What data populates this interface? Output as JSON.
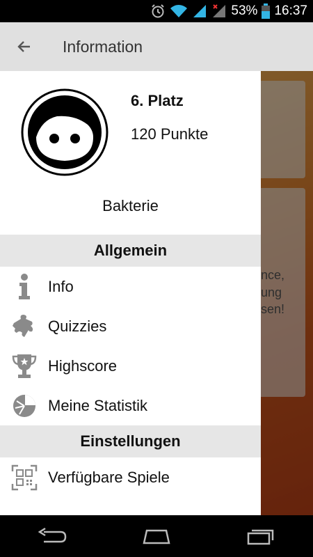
{
  "status_bar": {
    "battery_percent": "53%",
    "time": "16:37",
    "icons": [
      "alarm-icon",
      "wifi-icon",
      "signal-icon",
      "signal-no-data-icon",
      "battery-icon"
    ]
  },
  "app_bar": {
    "title": "Information",
    "back_icon": "arrow-back-icon"
  },
  "background": {
    "partial_texts": [
      "nce,",
      "ung",
      "sen!"
    ]
  },
  "drawer": {
    "profile": {
      "avatar_icon": "face-avatar-icon",
      "rank": "6. Platz",
      "points": "120 Punkte",
      "username": "Bakterie"
    },
    "sections": [
      {
        "title": "Allgemein",
        "items": [
          {
            "label": "Info",
            "icon": "info-icon"
          },
          {
            "label": "Quizzies",
            "icon": "puzzle-icon"
          },
          {
            "label": "Highscore",
            "icon": "trophy-icon"
          },
          {
            "label": "Meine Statistik",
            "icon": "pie-chart-icon"
          }
        ]
      },
      {
        "title": "Einstellungen",
        "items": [
          {
            "label": "Verfügbare Spiele",
            "icon": "qr-code-icon"
          }
        ]
      }
    ]
  },
  "nav_bar": {
    "buttons": [
      "back-nav-icon",
      "home-nav-icon",
      "recents-nav-icon"
    ]
  },
  "colors": {
    "app_bar_bg": "#e0e0e0",
    "section_header_bg": "#e6e6e6",
    "icon_gray": "#8a8a8a",
    "drawer_bg": "#ffffff"
  }
}
